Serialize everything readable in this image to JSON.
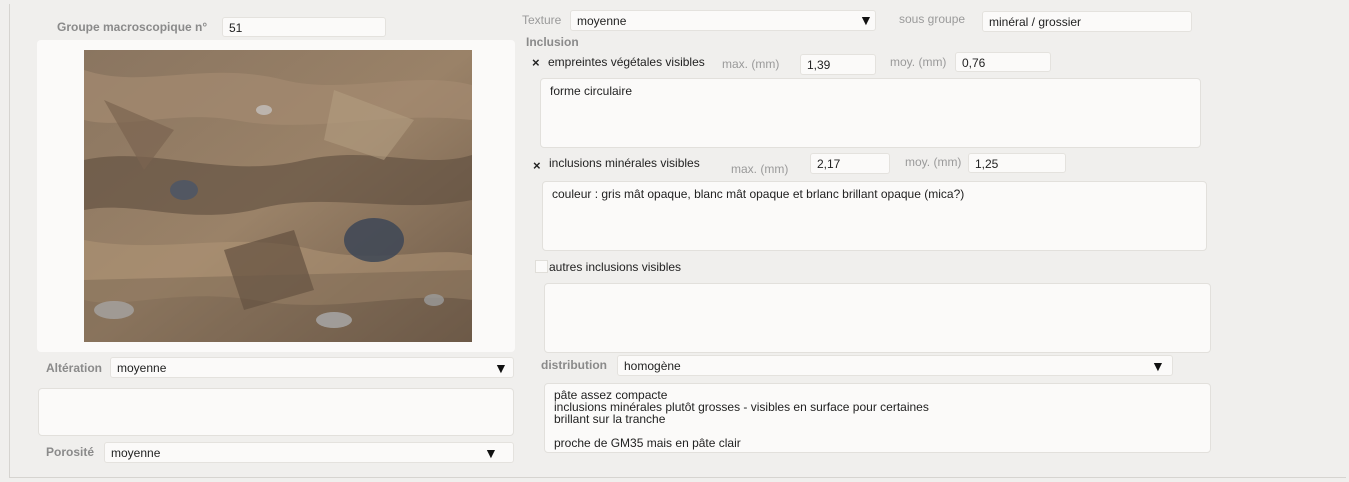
{
  "groupe": {
    "label": "Groupe macroscopique n°",
    "value": "51"
  },
  "texture": {
    "label": "Texture",
    "value": "moyenne",
    "arrow": "▼"
  },
  "sous_groupe": {
    "label": "sous groupe",
    "value": "minéral / grossier"
  },
  "inclusion": {
    "heading": "Inclusion"
  },
  "vegetales": {
    "check": "×",
    "label": "empreintes végétales visibles",
    "max_label": "max. (mm)",
    "max_value": "1,39",
    "moy_label": "moy. (mm)",
    "moy_value": "0,76",
    "note": "forme circulaire"
  },
  "minerales": {
    "check": "×",
    "label": "inclusions minérales visibles",
    "max_label": "max. (mm)",
    "max_value": "2,17",
    "moy_label": "moy. (mm)",
    "moy_value": "1,25",
    "note": "couleur : gris mât opaque, blanc mât opaque et brlanc brillant opaque (mica?)"
  },
  "autres": {
    "label": "autres inclusions visibles",
    "note": ""
  },
  "distribution": {
    "label": "distribution",
    "value": "homogène",
    "arrow": "▼"
  },
  "description": "pâte assez compacte\ninclusions minérales plutôt grosses - visibles en surface pour certaines\nbrillant sur la tranche\n\nproche de GM35 mais en pâte clair",
  "alteration": {
    "label": "Altération",
    "value": "moyenne",
    "arrow": "▼",
    "note": ""
  },
  "porosite": {
    "label": "Porosité",
    "value": "moyenne",
    "arrow": "▼"
  },
  "colors": {
    "background": "#f0efed",
    "field": "#fbfaf9",
    "label": "#8a8a8a"
  }
}
